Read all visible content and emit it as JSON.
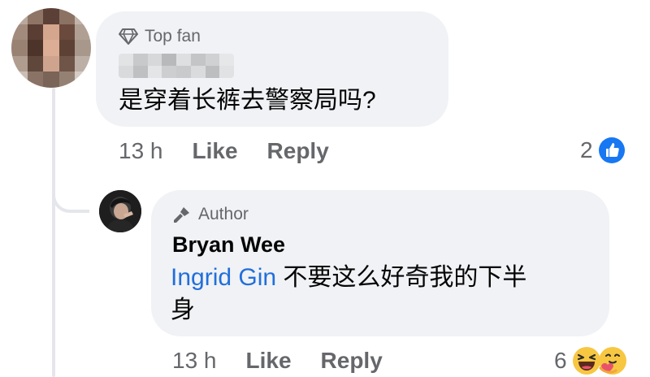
{
  "comment1": {
    "badge": "Top fan",
    "text": "是穿着长裤去警察局吗?",
    "time": "13 h",
    "like": "Like",
    "reply": "Reply",
    "reaction_count": "2"
  },
  "comment2": {
    "badge": "Author",
    "author": "Bryan Wee",
    "mention": "Ingrid Gin",
    "text_line1": " 不要这么好奇我的下半",
    "text_line2": "身",
    "time": "13 h",
    "like": "Like",
    "reply": "Reply",
    "reaction_count": "6"
  },
  "colors": {
    "bubble": "#f0f2f5",
    "meta_text": "#65676b",
    "mention": "#216fdb",
    "like_blue": "#1877f2"
  }
}
